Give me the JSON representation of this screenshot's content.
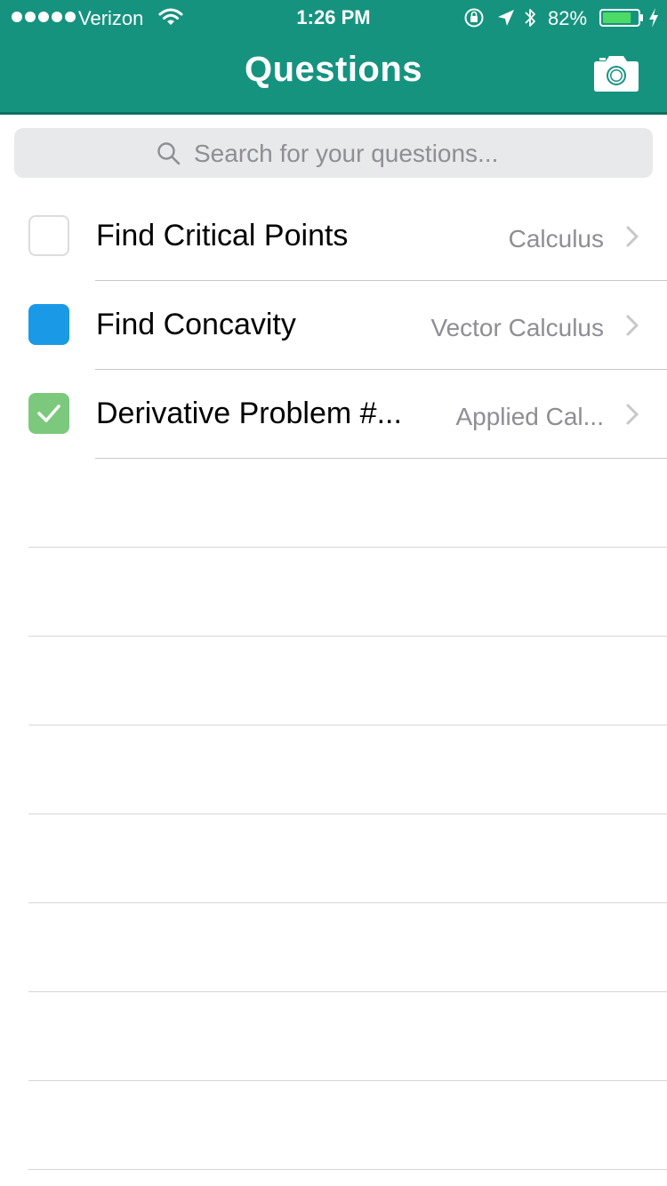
{
  "status_bar": {
    "carrier": "Verizon",
    "time": "1:26 PM",
    "battery_percent": "82%",
    "battery_level": 0.82,
    "signal_bars": 5,
    "icons": [
      "wifi-icon",
      "rotation-lock-icon",
      "location-arrow-icon",
      "bluetooth-icon",
      "battery-icon",
      "charging-bolt-icon"
    ]
  },
  "header": {
    "title": "Questions",
    "action_icon": "camera-icon",
    "background_color": "#16937f"
  },
  "search": {
    "placeholder": "Search for your questions..."
  },
  "questions": [
    {
      "title": "Find Critical Points",
      "subject": "Calculus",
      "status": "unchecked",
      "status_color": "#ffffff"
    },
    {
      "title": "Find Concavity",
      "subject": "Vector Calculus",
      "status": "in-progress",
      "status_color": "#1a9ae6"
    },
    {
      "title": "Derivative Problem #...",
      "subject": "Applied Cal...",
      "status": "checked",
      "status_color": "#7cc97e"
    }
  ]
}
